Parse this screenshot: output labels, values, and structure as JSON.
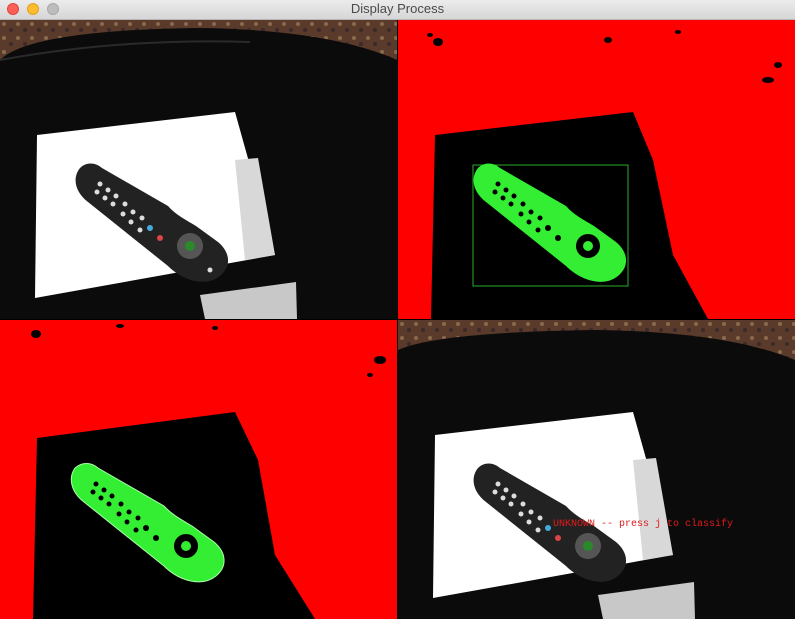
{
  "window": {
    "title": "Display Process"
  },
  "panels": [
    {
      "name": "original-frame"
    },
    {
      "name": "threshold-mask-bounding-box"
    },
    {
      "name": "threshold-mask-contour"
    },
    {
      "name": "classification-frame",
      "overlay_text": "UNKNOWN -- press j to classify"
    }
  ],
  "colors": {
    "mask_red": "#ff0000",
    "contour_green": "#33ee33",
    "label_red": "#e21a1a"
  }
}
